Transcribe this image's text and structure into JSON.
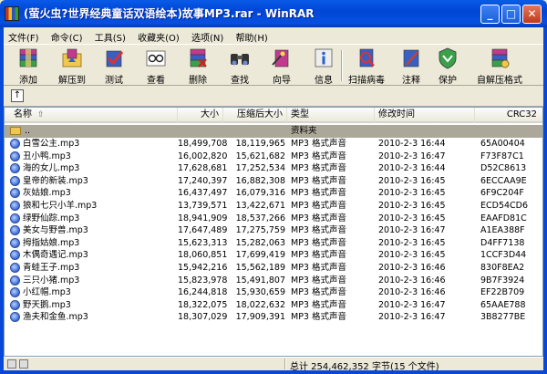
{
  "window": {
    "title": "(萤火虫?世界经典童话双语绘本)故事MP3.rar - WinRAR"
  },
  "menu": [
    "文件(F)",
    "命令(C)",
    "工具(S)",
    "收藏夹(O)",
    "选项(N)",
    "帮助(H)"
  ],
  "toolbar": [
    {
      "label": "添加",
      "icon": "add-archive-icon"
    },
    {
      "label": "解压到",
      "icon": "extract-to-icon"
    },
    {
      "label": "测试",
      "icon": "test-icon"
    },
    {
      "label": "查看",
      "icon": "view-icon"
    },
    {
      "label": "删除",
      "icon": "delete-icon"
    },
    {
      "label": "查找",
      "icon": "find-icon"
    },
    {
      "label": "向导",
      "icon": "wizard-icon"
    },
    {
      "label": "信息",
      "icon": "info-icon"
    },
    {
      "label": "扫描病毒",
      "icon": "scan-virus-icon"
    },
    {
      "label": "注释",
      "icon": "comment-icon"
    },
    {
      "label": "保护",
      "icon": "protect-icon"
    },
    {
      "label": "自解压格式",
      "icon": "sfx-icon"
    }
  ],
  "columns": [
    "名称",
    "大小",
    "压缩后大小",
    "类型",
    "修改时间",
    "CRC32"
  ],
  "parent_row": {
    "name": "..",
    "type": "资料夹"
  },
  "files": [
    {
      "name": "白雪公主.mp3",
      "size": "18,499,708",
      "packed": "18,119,965",
      "type": "MP3 格式声音",
      "modified": "2010-2-3 16:44",
      "crc": "65A00404"
    },
    {
      "name": "丑小鸭.mp3",
      "size": "16,002,820",
      "packed": "15,621,682",
      "type": "MP3 格式声音",
      "modified": "2010-2-3 16:47",
      "crc": "F73F87C1"
    },
    {
      "name": "海的女儿.mp3",
      "size": "17,628,681",
      "packed": "17,252,534",
      "type": "MP3 格式声音",
      "modified": "2010-2-3 16:44",
      "crc": "D52C8613"
    },
    {
      "name": "皇帝的新装.mp3",
      "size": "17,240,397",
      "packed": "16,882,308",
      "type": "MP3 格式声音",
      "modified": "2010-2-3 16:45",
      "crc": "6ECCAA9E"
    },
    {
      "name": "灰姑娘.mp3",
      "size": "16,437,497",
      "packed": "16,079,316",
      "type": "MP3 格式声音",
      "modified": "2010-2-3 16:45",
      "crc": "6F9C204F"
    },
    {
      "name": "狼和七只小羊.mp3",
      "size": "13,739,571",
      "packed": "13,422,671",
      "type": "MP3 格式声音",
      "modified": "2010-2-3 16:45",
      "crc": "ECD54CD6"
    },
    {
      "name": "绿野仙踪.mp3",
      "size": "18,941,909",
      "packed": "18,537,266",
      "type": "MP3 格式声音",
      "modified": "2010-2-3 16:45",
      "crc": "EAAFD81C"
    },
    {
      "name": "美女与野兽.mp3",
      "size": "17,647,489",
      "packed": "17,275,759",
      "type": "MP3 格式声音",
      "modified": "2010-2-3 16:47",
      "crc": "A1EA388F"
    },
    {
      "name": "拇指姑娘.mp3",
      "size": "15,623,313",
      "packed": "15,282,063",
      "type": "MP3 格式声音",
      "modified": "2010-2-3 16:45",
      "crc": "D4FF7138"
    },
    {
      "name": "木偶奇遇记.mp3",
      "size": "18,060,851",
      "packed": "17,699,419",
      "type": "MP3 格式声音",
      "modified": "2010-2-3 16:45",
      "crc": "1CCF3D44"
    },
    {
      "name": "青蛙王子.mp3",
      "size": "15,942,216",
      "packed": "15,562,189",
      "type": "MP3 格式声音",
      "modified": "2010-2-3 16:46",
      "crc": "830F8EA2"
    },
    {
      "name": "三只小猪.mp3",
      "size": "15,823,978",
      "packed": "15,491,807",
      "type": "MP3 格式声音",
      "modified": "2010-2-3 16:46",
      "crc": "9B7F3924"
    },
    {
      "name": "小红帽.mp3",
      "size": "16,244,818",
      "packed": "15,930,659",
      "type": "MP3 格式声音",
      "modified": "2010-2-3 16:46",
      "crc": "EF22B709"
    },
    {
      "name": "野天鹅.mp3",
      "size": "18,322,075",
      "packed": "18,022,632",
      "type": "MP3 格式声音",
      "modified": "2010-2-3 16:47",
      "crc": "65AAE788"
    },
    {
      "name": "渔夫和金鱼.mp3",
      "size": "18,307,029",
      "packed": "17,909,391",
      "type": "MP3 格式声音",
      "modified": "2010-2-3 16:47",
      "crc": "3B8277BE"
    }
  ],
  "status": {
    "total": "总计 254,462,352 字节(15 个文件)"
  },
  "colors": {
    "title_bar": "#0054e3",
    "window_bg": "#ece9d8",
    "list_bg": "#ffffff",
    "folder_row": "#aca899"
  }
}
